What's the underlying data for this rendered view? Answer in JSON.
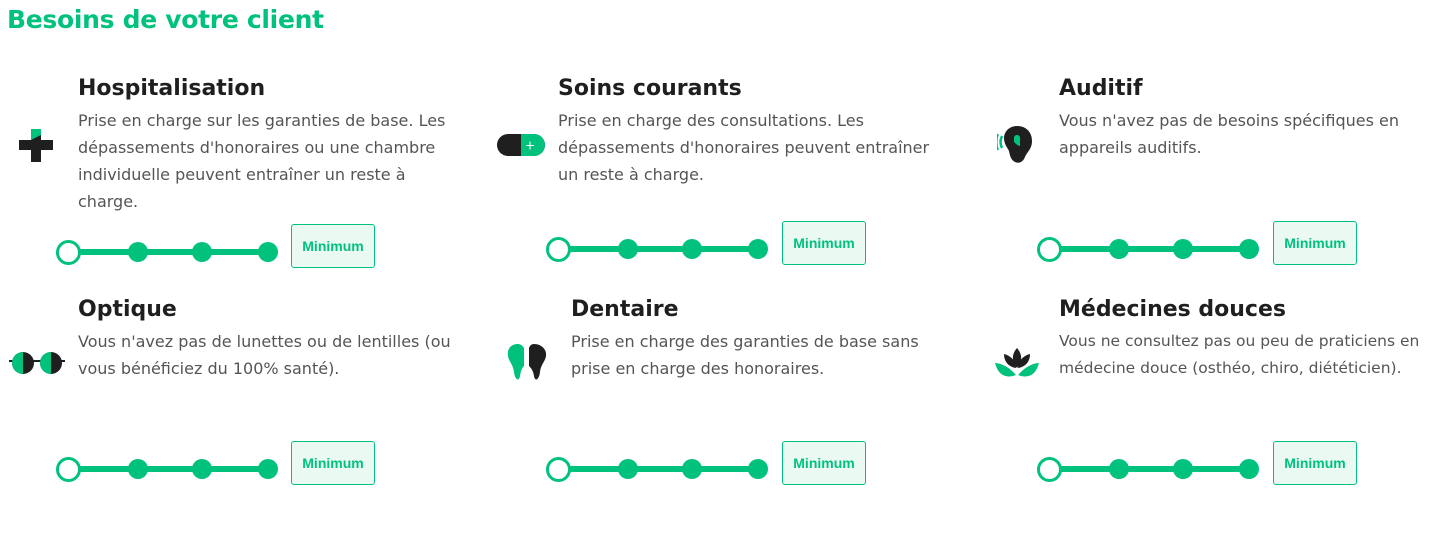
{
  "page": {
    "title": "Besoins de votre client"
  },
  "cards": [
    {
      "title": "Hospitalisation",
      "description": "Prise en charge sur les garanties de base. Les dépassements d'honoraires ou une chambre individuelle peuvent entraîner un reste à charge.",
      "icon": "medical-cross-icon",
      "level_label": "Minimum",
      "level": 0
    },
    {
      "title": "Soins courants",
      "description": "Prise en charge des consultations. Les dépassements d'honoraires peuvent entraîner un reste à charge.",
      "icon": "pill-capsule-icon",
      "level_label": "Minimum",
      "level": 0
    },
    {
      "title": "Auditif",
      "description": "Vous n'avez pas de besoins spécifiques en appareils auditifs.",
      "icon": "ear-icon",
      "level_label": "Minimum",
      "level": 0
    },
    {
      "title": "Optique",
      "description": "Vous n'avez pas de lunettes ou de lentilles (ou vous bénéficiez du 100% santé).",
      "icon": "glasses-icon",
      "level_label": "Minimum",
      "level": 0
    },
    {
      "title": "Dentaire",
      "description": "Prise en charge des garanties de base sans prise en charge des honoraires.",
      "icon": "tooth-icon",
      "level_label": "Minimum",
      "level": 0
    },
    {
      "title": "Médecines douces",
      "description": "Vous ne consultez pas ou peu de praticiens en médecine douce (osthéo, chiro, diététicien).",
      "icon": "lotus-icon",
      "level_label": "Minimum",
      "level": 0
    }
  ],
  "colors": {
    "accent": "#00c27c",
    "accent_light": "#eafaf3",
    "title_text": "#1f1f1f",
    "body_text": "#555555",
    "icon_dark": "#1f1f1f"
  }
}
